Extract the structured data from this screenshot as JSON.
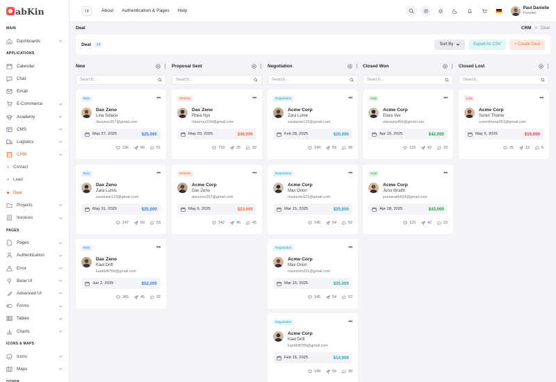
{
  "brand": {
    "name": "abKin",
    "accent": "#ff5a1f"
  },
  "sidebar": {
    "sections": {
      "main": "MAIN",
      "applications": "APPLICATIONS",
      "pages": "PAGES",
      "icons_maps": "ICONS & MAPS",
      "other": "OTHER"
    },
    "items": {
      "dashboards": "Dashboards",
      "calendar": "Calendar",
      "chat": "Chat",
      "email": "Email",
      "ecommerce": "E-Commerce",
      "academy": "Academy",
      "cms": "CMS",
      "logistics": "Logistics",
      "crm": "CRM",
      "contact": "Contact",
      "lead": "Lead",
      "deal": "Deal",
      "projects": "Projects",
      "invoices": "Invoices",
      "pages": "Pages",
      "authentication": "Authentication",
      "error": "Error",
      "base_ui": "Base UI",
      "advanced_ui": "Advanced UI",
      "forms": "Forms",
      "tables": "Tables",
      "charts": "Charts",
      "icons": "Icons",
      "maps": "Maps"
    }
  },
  "header": {
    "nav": [
      "About",
      "Authentication & Pages",
      "Help"
    ],
    "user": {
      "name": "Paul Danielle",
      "role": "Founder"
    }
  },
  "page": {
    "title": "Deal",
    "breadcrumb": [
      "CRM",
      ">",
      "Deal"
    ]
  },
  "deal_bar": {
    "title": "Deal",
    "count": "13",
    "sort_label": "Sort By",
    "export_label": "Export As CSV",
    "create_label": "+ Create Deal"
  },
  "search_placeholder": "Search...",
  "columns": [
    {
      "title": "New",
      "cards": [
        {
          "tag": "New",
          "tag_style": "new",
          "name": "Dax Zeno",
          "sub": "Lina Solace",
          "email": "daxzeno357@gmail.com",
          "date": "May 27, 2025",
          "amount": "$25,000",
          "likes": "236",
          "shares": "89",
          "comments": "51"
        },
        {
          "tag": "New",
          "tag_style": "new",
          "name": "Dax Zeno",
          "sub": "Zara Lumis",
          "email": "zaralume123@gmail.com",
          "date": "May 31, 2025",
          "amount": "$25,000",
          "likes": "147",
          "shares": "69",
          "comments": "53"
        },
        {
          "tag": "New",
          "tag_style": "new",
          "name": "Dax Zeno",
          "sub": "Kael Drift",
          "email": "kaeldrift789@gmail.com",
          "date": "Jun 2, 2025",
          "amount": "$52,000",
          "likes": "265",
          "shares": "45",
          "comments": "32"
        }
      ]
    },
    {
      "title": "Proposal Sent",
      "cards": [
        {
          "tag": "Website",
          "tag_style": "website",
          "name": "Dax Zeno",
          "sub": "Rhea Nyx",
          "email": "rhearnyx159@gmail.com",
          "date": "May 20, 2025",
          "amount": "$36,000",
          "likes": "710",
          "shares": "25",
          "comments": "32"
        },
        {
          "tag": "Website",
          "tag_style": "website",
          "name": "Acme Corp",
          "sub": "Dax Zeno",
          "email": "daxzeno357@gmail.com",
          "date": "May 5, 2025",
          "amount": "$23,000",
          "likes": "142",
          "shares": "45",
          "comments": "45"
        }
      ]
    },
    {
      "title": "Negotiation",
      "cards": [
        {
          "tag": "Negotiation",
          "tag_style": "negotiation",
          "name": "Acme Corp",
          "sub": "Zara Lume",
          "email": "zaralume123@gmail.com",
          "date": "Feb 28, 2025",
          "amount": "$20,000",
          "likes": "149",
          "shares": "59",
          "comments": "39"
        },
        {
          "tag": "Negotiation",
          "tag_style": "negotiation",
          "name": "Acme Corp",
          "sub": "Max Orion",
          "email": "maxorion321@gmail.com",
          "date": "Mar 15, 2025",
          "amount": "$25,000",
          "likes": "145",
          "shares": "54",
          "comments": "52"
        },
        {
          "tag": "Negotiation",
          "tag_style": "negotiation",
          "name": "Acme Corp",
          "sub": "Max Orion",
          "email": "maxorion321@gmail.com",
          "date": "Mar 15, 2025",
          "amount": "$35,000",
          "likes": "145",
          "shares": "54",
          "comments": "52"
        },
        {
          "tag": "Negotiation",
          "tag_style": "negotiation",
          "name": "Acme Corp",
          "sub": "Kael Drift",
          "email": "kaeldrift789@gmail.com",
          "date": "Feb 15, 2025",
          "amount": "$14,000",
          "likes": "149",
          "shares": "56",
          "comments": "39"
        }
      ]
    },
    {
      "title": "Closed Won",
      "cards": [
        {
          "tag": "High",
          "tag_style": "high",
          "name": "Acme Corp",
          "sub": "Elara Vex",
          "email": "elaravex456@gmail.com",
          "date": "Apr 16, 2025",
          "amount": "$42,000",
          "likes": "123",
          "shares": "42",
          "comments": "23"
        },
        {
          "tag": "High",
          "tag_style": "high",
          "name": "Acme Corp",
          "sub": "Juno Wraith",
          "email": "junowraith654@gmail.com",
          "date": "Apr 28, 2025",
          "amount": "$43,000",
          "likes": "123",
          "shares": "42",
          "comments": "23"
        }
      ]
    },
    {
      "title": "Closed Lost",
      "cards": [
        {
          "tag": "Low",
          "tag_style": "low",
          "name": "Acme Corp",
          "sub": "Soren Thorne",
          "email": "sorenthorne951@gmail.com",
          "date": "May 5, 2025",
          "amount": "$10,000",
          "likes": "25",
          "shares": "12",
          "comments": "5"
        }
      ]
    }
  ]
}
